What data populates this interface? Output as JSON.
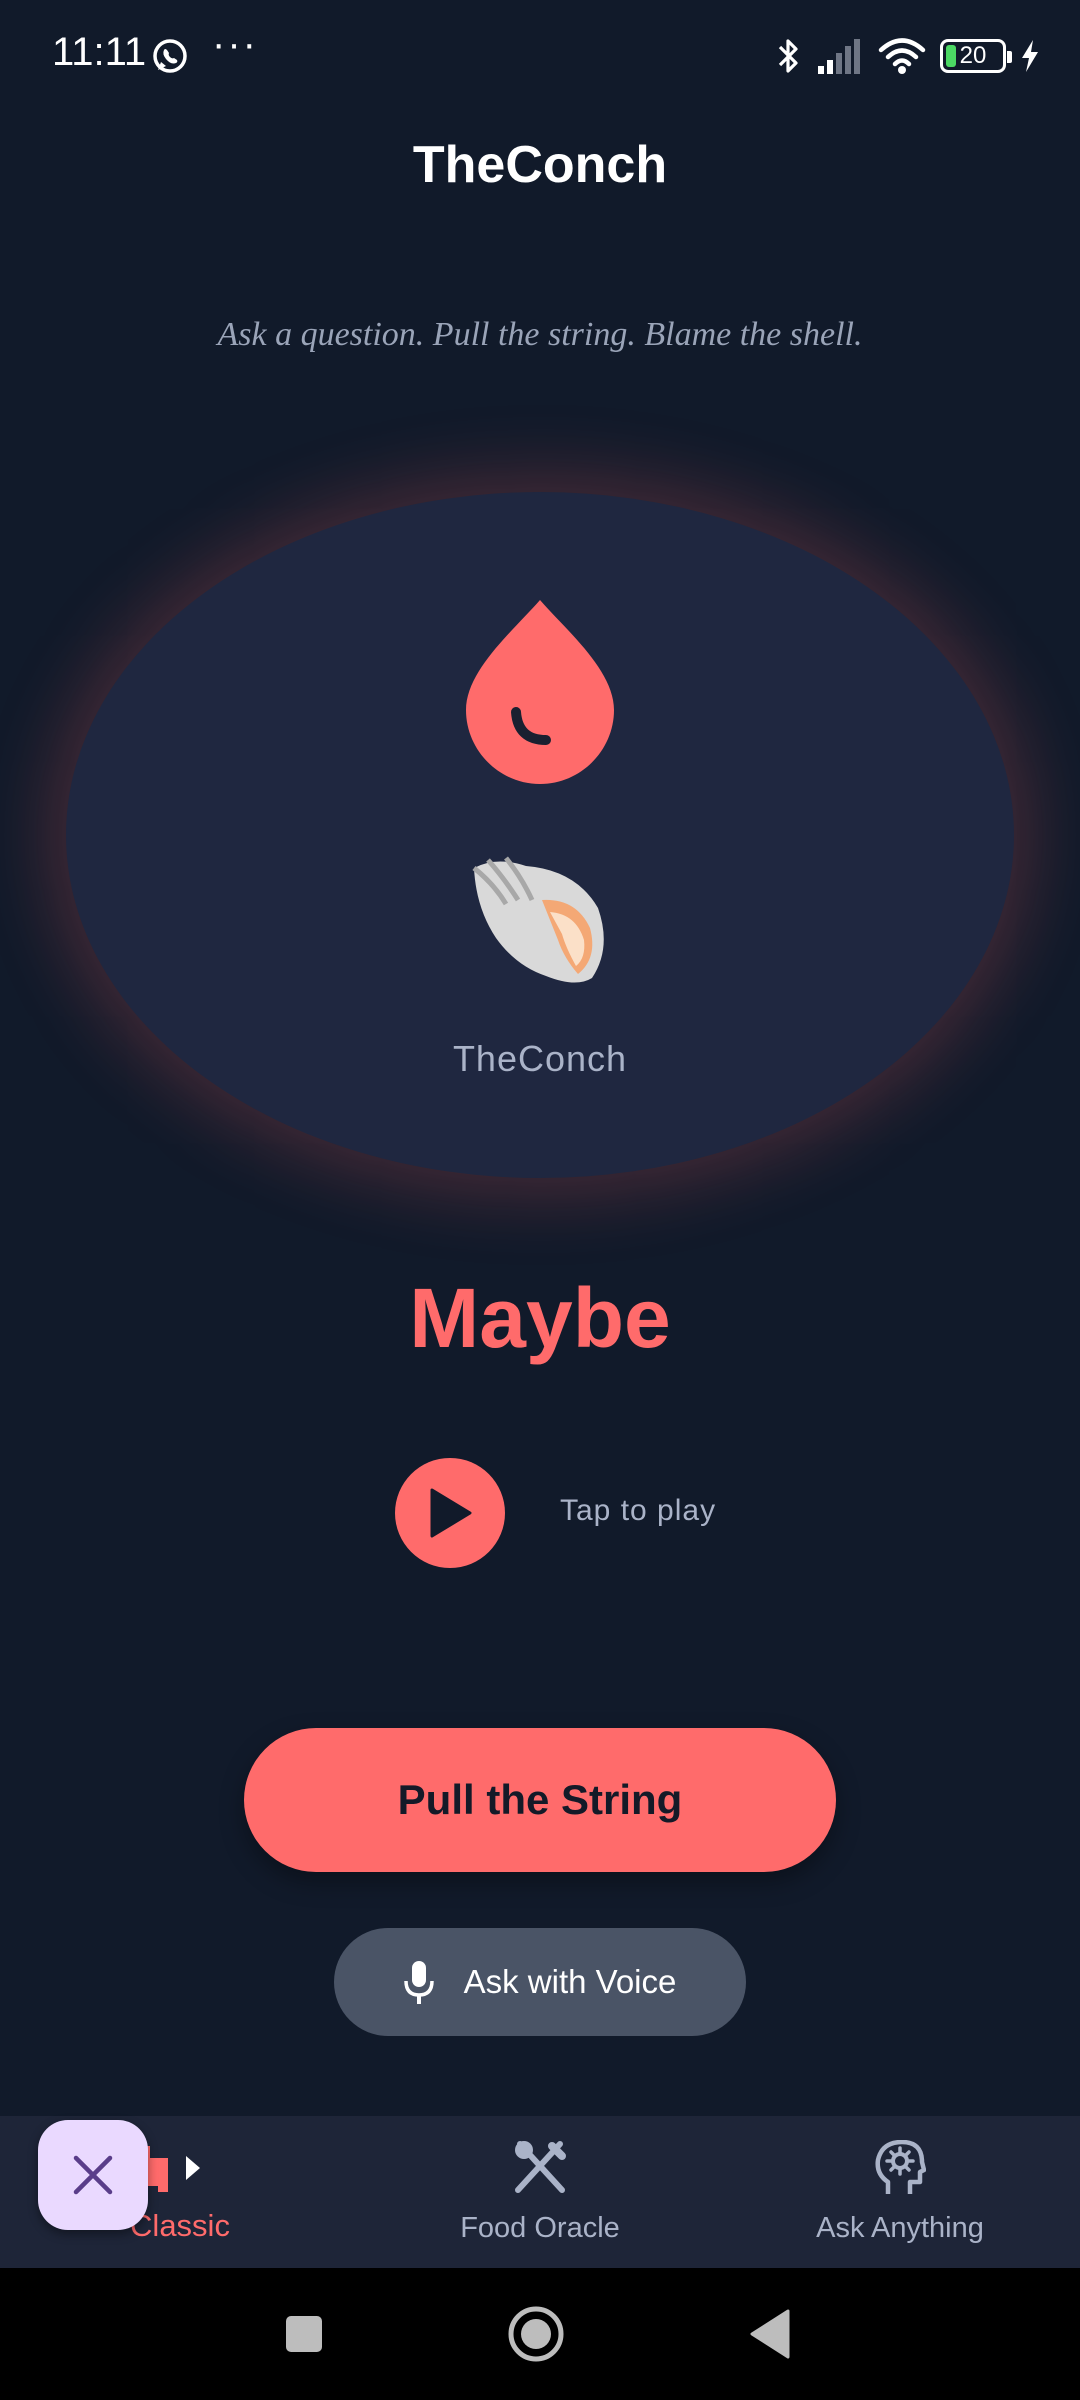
{
  "status_bar": {
    "time": "11:11",
    "more": "···",
    "battery_level": "20",
    "icons": [
      "whatsapp-icon",
      "bluetooth-icon",
      "signal-icon",
      "wifi-icon",
      "battery-icon",
      "charging-icon"
    ]
  },
  "header": {
    "title": "TheConch",
    "tagline": "Ask a question. Pull the string. Blame the shell."
  },
  "conch": {
    "label": "TheConch",
    "icons": [
      "drop-icon",
      "shell-icon"
    ]
  },
  "answer": "Maybe",
  "player": {
    "label": "Tap to play"
  },
  "actions": {
    "pull_label": "Pull the String",
    "voice_label": "Ask with Voice"
  },
  "nav": {
    "items": [
      {
        "label": "Classic",
        "icon": "chat-bubbles-icon",
        "active": true
      },
      {
        "label": "Food Oracle",
        "icon": "utensils-icon",
        "active": false
      },
      {
        "label": "Ask Anything",
        "icon": "brain-head-icon",
        "active": false
      }
    ]
  },
  "colors": {
    "background": "#111a2a",
    "card": "#1f2740",
    "accent": "#ff6b6b",
    "muted_text": "#aab3c8",
    "voice_button": "#4a5466",
    "nav_background": "#1e2538",
    "close_fab": "#ead9ff"
  }
}
